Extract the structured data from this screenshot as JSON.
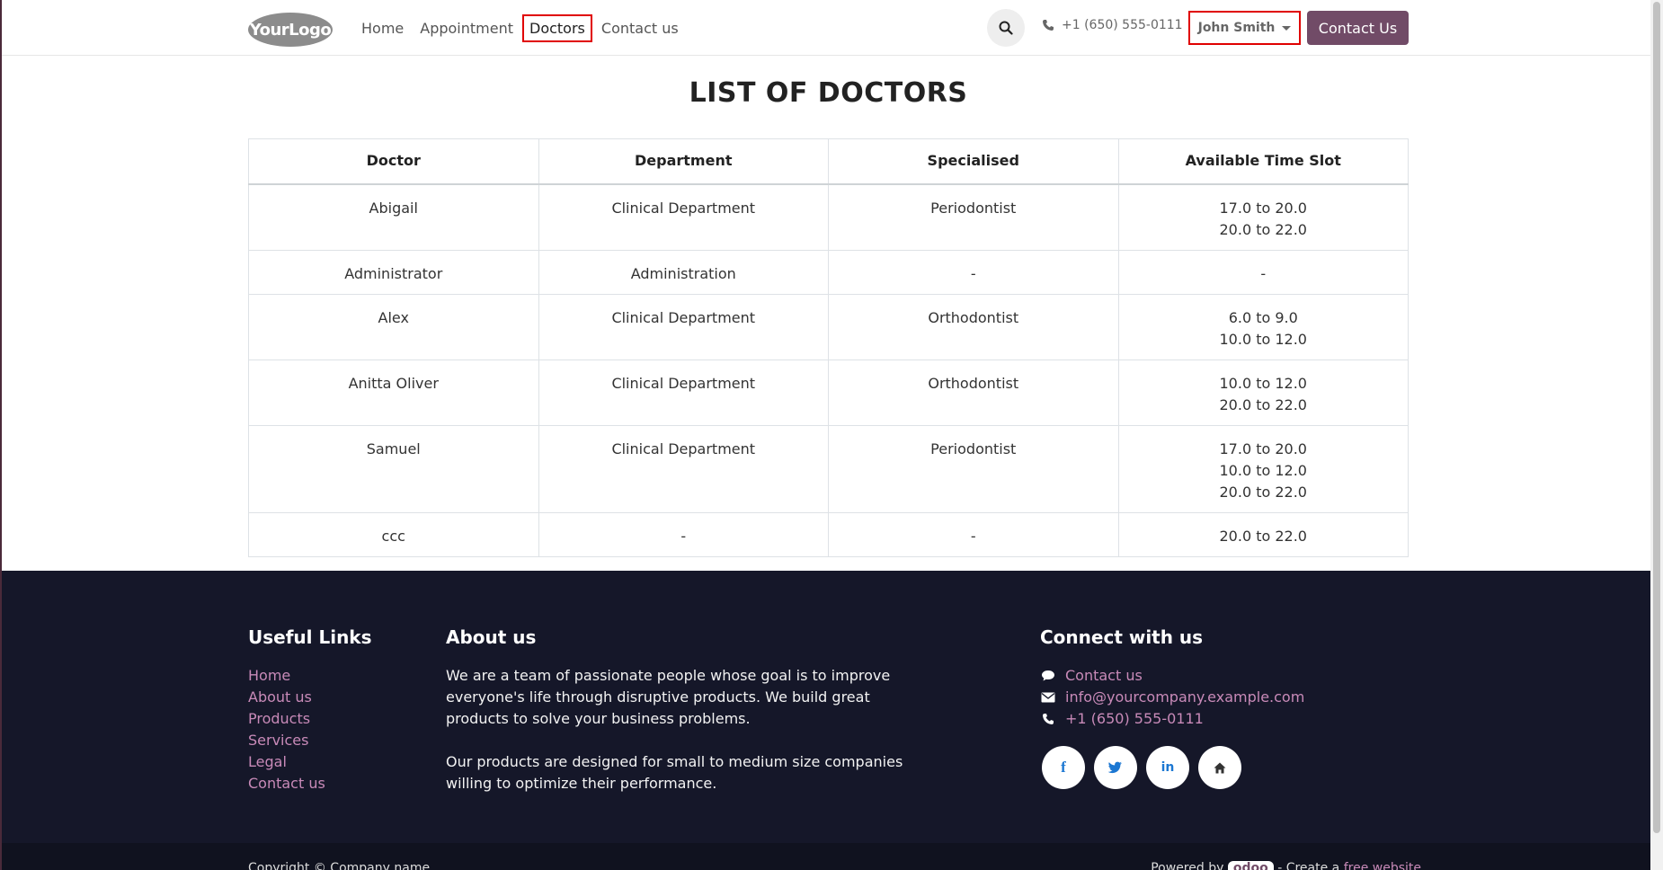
{
  "header": {
    "logo_text": "YourLogo",
    "nav": [
      "Home",
      "Appointment",
      "Doctors",
      "Contact us"
    ],
    "active_nav": "Doctors",
    "phone": "+1 (650) 555-0111",
    "user_name": "John Smith",
    "contact_button": "Contact Us"
  },
  "main": {
    "title": "LIST OF DOCTORS",
    "table": {
      "headers": [
        "Doctor",
        "Department",
        "Specialised",
        "Available Time Slot"
      ],
      "rows": [
        {
          "doctor": "Abigail",
          "department": "Clinical Department",
          "specialised": "Periodontist",
          "slots": [
            "17.0 to 20.0",
            "20.0 to 22.0"
          ]
        },
        {
          "doctor": "Administrator",
          "department": "Administration",
          "specialised": "-",
          "slots": [
            "-"
          ]
        },
        {
          "doctor": "Alex",
          "department": "Clinical Department",
          "specialised": "Orthodontist",
          "slots": [
            "6.0 to 9.0",
            "10.0 to 12.0"
          ]
        },
        {
          "doctor": "Anitta Oliver",
          "department": "Clinical Department",
          "specialised": "Orthodontist",
          "slots": [
            "10.0 to 12.0",
            "20.0 to 22.0"
          ]
        },
        {
          "doctor": "Samuel",
          "department": "Clinical Department",
          "specialised": "Periodontist",
          "slots": [
            "17.0 to 20.0",
            "10.0 to 12.0",
            "20.0 to 22.0"
          ]
        },
        {
          "doctor": "ccc",
          "department": "-",
          "specialised": "-",
          "slots": [
            "20.0 to 22.0"
          ]
        }
      ]
    }
  },
  "footer": {
    "useful_links": {
      "title": "Useful Links",
      "items": [
        "Home",
        "About us",
        "Products",
        "Services",
        "Legal",
        "Contact us"
      ]
    },
    "about": {
      "title": "About us",
      "paragraph1": "We are a team of passionate people whose goal is to improve everyone's life through disruptive products. We build great products to solve your business problems.",
      "paragraph2": "Our products are designed for small to medium size companies willing to optimize their performance."
    },
    "connect": {
      "title": "Connect with us",
      "contact": "Contact us",
      "email": "info@yourcompany.example.com",
      "phone": "+1 (650) 555-0111",
      "social": [
        "facebook-icon",
        "twitter-icon",
        "linkedin-icon",
        "home-icon"
      ]
    },
    "copyright": "Copyright © Company name",
    "powered_by": "Powered by",
    "odoo": "odoo",
    "create_text": "- Create a",
    "free_website": "free website"
  },
  "colors": {
    "brand": "#714B67",
    "link": "#c88ab8",
    "footer_bg": "#151729",
    "highlight": "#e00000"
  }
}
